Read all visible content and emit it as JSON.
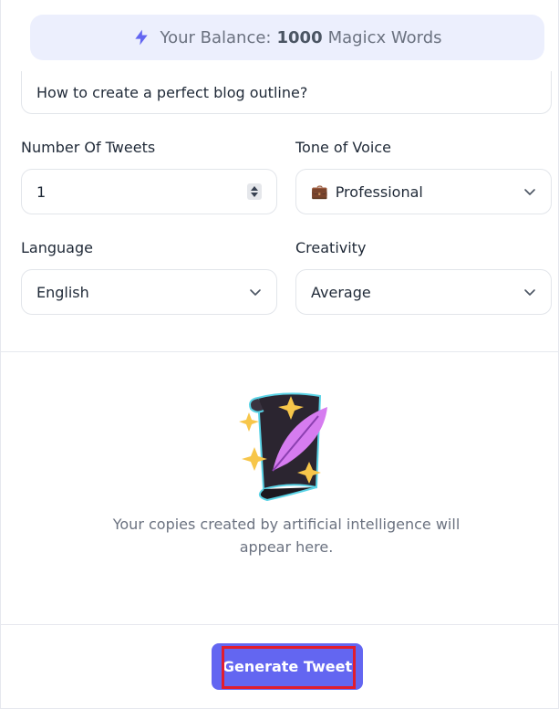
{
  "balance": {
    "prefix": "Your Balance:",
    "amount": "1000",
    "suffix": "Magicx Words",
    "icon": "bolt-icon",
    "background_color": "#eceffd",
    "icon_color": "#6366f1"
  },
  "topic": {
    "value": "How to create a perfect blog outline?"
  },
  "form": {
    "tweets": {
      "label": "Number Of Tweets",
      "value": "1"
    },
    "tone": {
      "label": "Tone of Voice",
      "value": "Professional",
      "icon": "briefcase-icon"
    },
    "language": {
      "label": "Language",
      "value": "English"
    },
    "creativity": {
      "label": "Creativity",
      "value": "Average"
    }
  },
  "empty_state": {
    "illustration": "scroll-feather-sparkles",
    "text": "Your copies created by artificial intelligence will appear here."
  },
  "actions": {
    "generate_label": "Generate Tweet",
    "primary_color": "#6366f1",
    "highlight_color": "#e11d2e"
  }
}
